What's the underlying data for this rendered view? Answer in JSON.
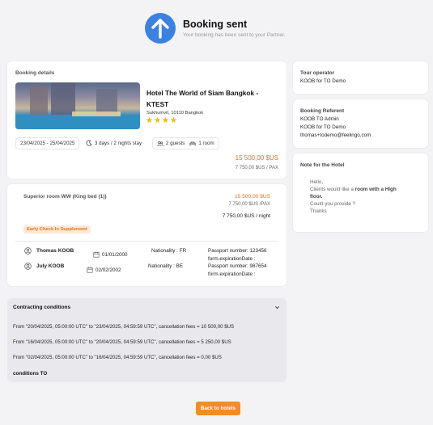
{
  "header": {
    "title": "Booking sent",
    "subtitle": "Your booking has been sent to your Partner."
  },
  "booking": {
    "section_label": "Booking details",
    "hotel_name_line1": "Hotel The World of Siam Bangkok -",
    "hotel_name_line2": "KTEST",
    "address": "Sukhumvit, 10110 Bangkok",
    "stars": "★★★★",
    "dates": "23/04/2025 - 25/04/2025",
    "stay": "3 days / 2 nights stay",
    "guests": "2 guests",
    "rooms": "1 room",
    "total_price": "15 500,00 $US",
    "price_per_pax": "7 750,00 $US / PAX"
  },
  "room": {
    "name": "Superior room WW (King bed (1))",
    "price": "15 500,00 $US",
    "price_per_pax": "7 750,00 $US /PAX",
    "price_per_night": "7 750,00 $US / night",
    "supplement": "Early Check In Supplement",
    "guests": [
      {
        "name": "Thomas KOOB",
        "birthdate": "01/01/2000",
        "nationality": "Nationality : FR",
        "passport": "Passport number: 123456",
        "expiration": "form.expirationDate :"
      },
      {
        "name": "July KOOB",
        "birthdate": "02/02/2002",
        "nationality": "Nationality : BE",
        "passport": "Passport number: 987654",
        "expiration": "form.expirationDate :"
      }
    ]
  },
  "conditions": {
    "title": "Contracting conditions",
    "lines": [
      "From \"20/04/2025, 05:00:00 UTC\" to \"23/04/2025, 04:59:59 UTC\", cancellation fees = 10 500,00 $US",
      "From \"16/04/2025, 05:00:00 UTC\" to \"20/04/2025, 04:59:59 UTC\", cancellation fees = 5 250,00 $US",
      "From \"02/04/2025, 05:00:00 UTC\" to \"16/04/2025, 04:59:59 UTC\", cancellation fees = 0,00 $US"
    ],
    "footer": "conditions TO"
  },
  "tour_operator": {
    "label": "Tour operator",
    "value": "KOOB for TO Demo"
  },
  "referent": {
    "label": "Booking Referent",
    "line1": "KOOB TO Admin",
    "line2": "KOOB for TO Demo",
    "line3": "thomas+todemo@feelingo.com"
  },
  "note": {
    "label": "Note for the Hotel",
    "hello": "Hello,",
    "line1_pre": "Clients would like a ",
    "line1_bold": "room with a High",
    "line2_bold": "floor.",
    "line3": "Could you provide ?",
    "line4": "Thanks"
  },
  "actions": {
    "back_label": "Back to hotels"
  },
  "colors": {
    "accent": "#f28c28",
    "icon_blue": "#3b82e0",
    "price": "#e2731b"
  }
}
